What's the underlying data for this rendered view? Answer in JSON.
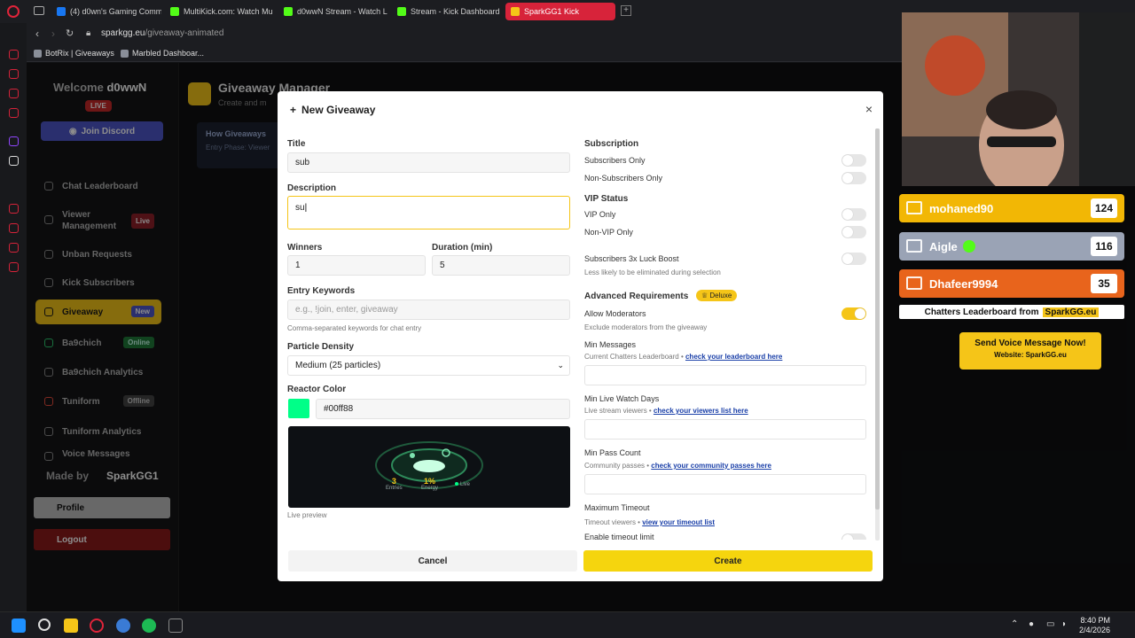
{
  "browser": {
    "tabs": [
      {
        "label": "(4) d0wn's Gaming Comm",
        "color": "#1877f2"
      },
      {
        "label": "MultiKick.com: Watch Mu",
        "color": "#53fc18"
      },
      {
        "label": "d0wwN Stream - Watch L",
        "color": "#53fc18"
      },
      {
        "label": "Stream - Kick Dashboard",
        "color": "#53fc18"
      },
      {
        "label": "SparkGG1 Kick",
        "color": "#f5c518"
      }
    ],
    "new_tab": "+",
    "url_host": "sparkgg.eu",
    "url_path": "/giveaway-animated",
    "bookmarks": [
      "BotRix | Giveaways",
      "Marbled Dashboar..."
    ]
  },
  "sidebar": {
    "welcome_prefix": "Welcome",
    "username": "d0wwN",
    "live_badge": "LIVE",
    "discord": "Join Discord",
    "items": [
      {
        "label": "Chat Leaderboard",
        "badge": ""
      },
      {
        "label": "Viewer Management",
        "badge": "Live"
      },
      {
        "label": "Unban Requests",
        "badge": ""
      },
      {
        "label": "Kick Subscribers",
        "badge": ""
      },
      {
        "label": "Giveaway",
        "badge": "New"
      },
      {
        "label": "Ba9chich",
        "badge": "Online"
      },
      {
        "label": "Ba9chich Analytics",
        "badge": ""
      },
      {
        "label": "Tuniform",
        "badge": "Offline"
      },
      {
        "label": "Tuniform Analytics",
        "badge": ""
      },
      {
        "label": "Voice Messages",
        "badge": ""
      }
    ],
    "made_by": "Made by",
    "made_by_name": "SparkGG1",
    "profile": "Profile",
    "logout": "Logout"
  },
  "main": {
    "title": "Giveaway Manager",
    "subtitle": "Create and m",
    "howto_title": "How Giveaways",
    "howto_sub": "Entry Phase: Viewer"
  },
  "modal": {
    "title": "New Giveaway",
    "close": "×",
    "title_label": "Title",
    "title_value": "sub",
    "desc_label": "Description",
    "desc_value": "su",
    "winners_label": "Winners",
    "winners_value": "1",
    "duration_label": "Duration (min)",
    "duration_value": "5",
    "keywords_label": "Entry Keywords",
    "keywords_placeholder": "e.g., !join, enter, giveaway",
    "keywords_hint": "Comma-separated keywords for chat entry",
    "density_label": "Particle Density",
    "density_value": "Medium (25 particles)",
    "color_label": "Reactor Color",
    "color_value": "#00ff88",
    "preview_entries": "3",
    "preview_entries_label": "Entries",
    "preview_energy": "1%",
    "preview_energy_label": "Energy",
    "preview_live": "Live",
    "preview_caption": "Live preview",
    "subscription_head": "Subscription",
    "subs_only": "Subscribers Only",
    "nonsubs_only": "Non-Subscribers Only",
    "vip_head": "VIP Status",
    "vip_only": "VIP Only",
    "nonvip_only": "Non-VIP Only",
    "luck_boost": "Subscribers 3x Luck Boost",
    "luck_hint": "Less likely to be eliminated during selection",
    "adv_head": "Advanced Requirements",
    "deluxe": "Deluxe",
    "allow_mods": "Allow Moderators",
    "allow_mods_hint": "Exclude moderators from the giveaway",
    "min_messages": "Min Messages",
    "min_messages_hint": "Current Chatters Leaderboard •",
    "min_messages_link": "check your leaderboard here",
    "min_watch": "Min Live Watch Days",
    "min_watch_hint": "Live stream viewers •",
    "min_watch_link": "check your viewers list here",
    "min_pass": "Min Pass Count",
    "min_pass_hint": "Community passes •",
    "min_pass_link": "check your community passes here",
    "max_timeout": "Maximum Timeout",
    "max_timeout_hint": "Timeout viewers •",
    "max_timeout_link": "view your timeout list",
    "enable_timeout": "Enable timeout limit",
    "cancel": "Cancel",
    "create": "Create",
    "allow_mods_on": true
  },
  "overlay": {
    "leaderboard": [
      {
        "name": "mohaned90",
        "score": "124",
        "color": "#f2b705"
      },
      {
        "name": "Aigle",
        "score": "116",
        "color": "#9aa3b5"
      },
      {
        "name": "Dhafeer9994",
        "score": "35",
        "color": "#e8641c"
      }
    ],
    "footer_prefix": "Chatters Leaderboard from",
    "footer_brand": "SparkGG.eu",
    "voice_title": "Send Voice Message Now!",
    "voice_sub": "Website: SparkGG.eu"
  },
  "taskbar": {
    "time": "8:40 PM",
    "date": "2/4/2026"
  }
}
